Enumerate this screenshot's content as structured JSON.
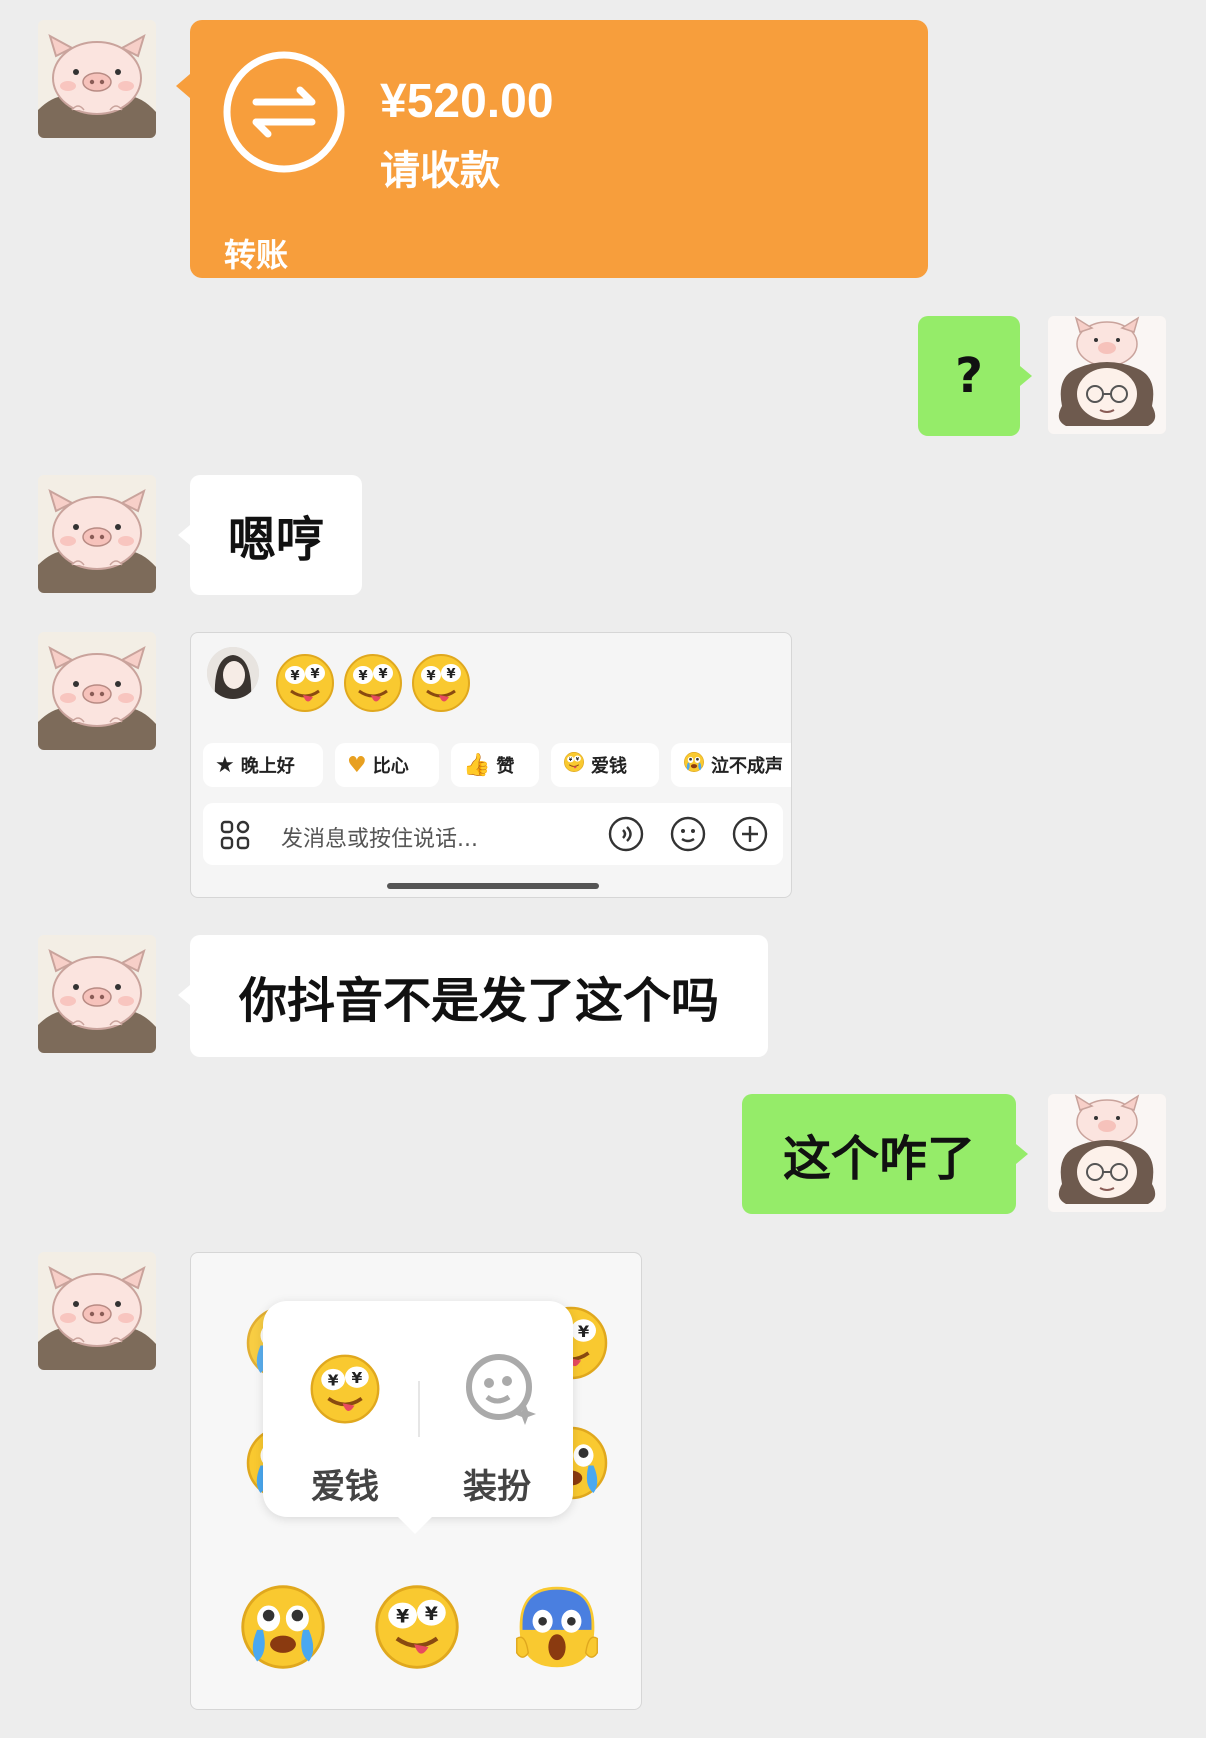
{
  "transfer": {
    "amount": "¥520.00",
    "status": "请收款",
    "kind": "转账",
    "color": "#f79e3c"
  },
  "messages": [
    {
      "side": "right",
      "text": "?"
    },
    {
      "side": "left",
      "text": "嗯哼"
    },
    {
      "side": "left",
      "text": "你抖音不是发了这个吗"
    },
    {
      "side": "right",
      "text": "这个咋了"
    }
  ],
  "screenshot_card": {
    "chips": [
      {
        "icon": "star-emoji-icon",
        "label": "晚上好"
      },
      {
        "icon": "heart-hands-emoji-icon",
        "label": "比心"
      },
      {
        "icon": "thumbs-up-icon",
        "label": "赞"
      },
      {
        "icon": "money-eyes-emoji-icon",
        "label": "爱钱"
      },
      {
        "icon": "crying-emoji-icon",
        "label": "泣不成声"
      }
    ],
    "input_placeholder": "发消息或按住说话..."
  },
  "popup_card": {
    "options": [
      {
        "icon": "money-eyes-emoji-icon",
        "label": "爱钱"
      },
      {
        "icon": "dress-up-face-icon",
        "label": "装扮"
      }
    ]
  },
  "colors": {
    "background": "#ededed",
    "sent_bubble": "#95ec69",
    "received_bubble": "#ffffff"
  }
}
